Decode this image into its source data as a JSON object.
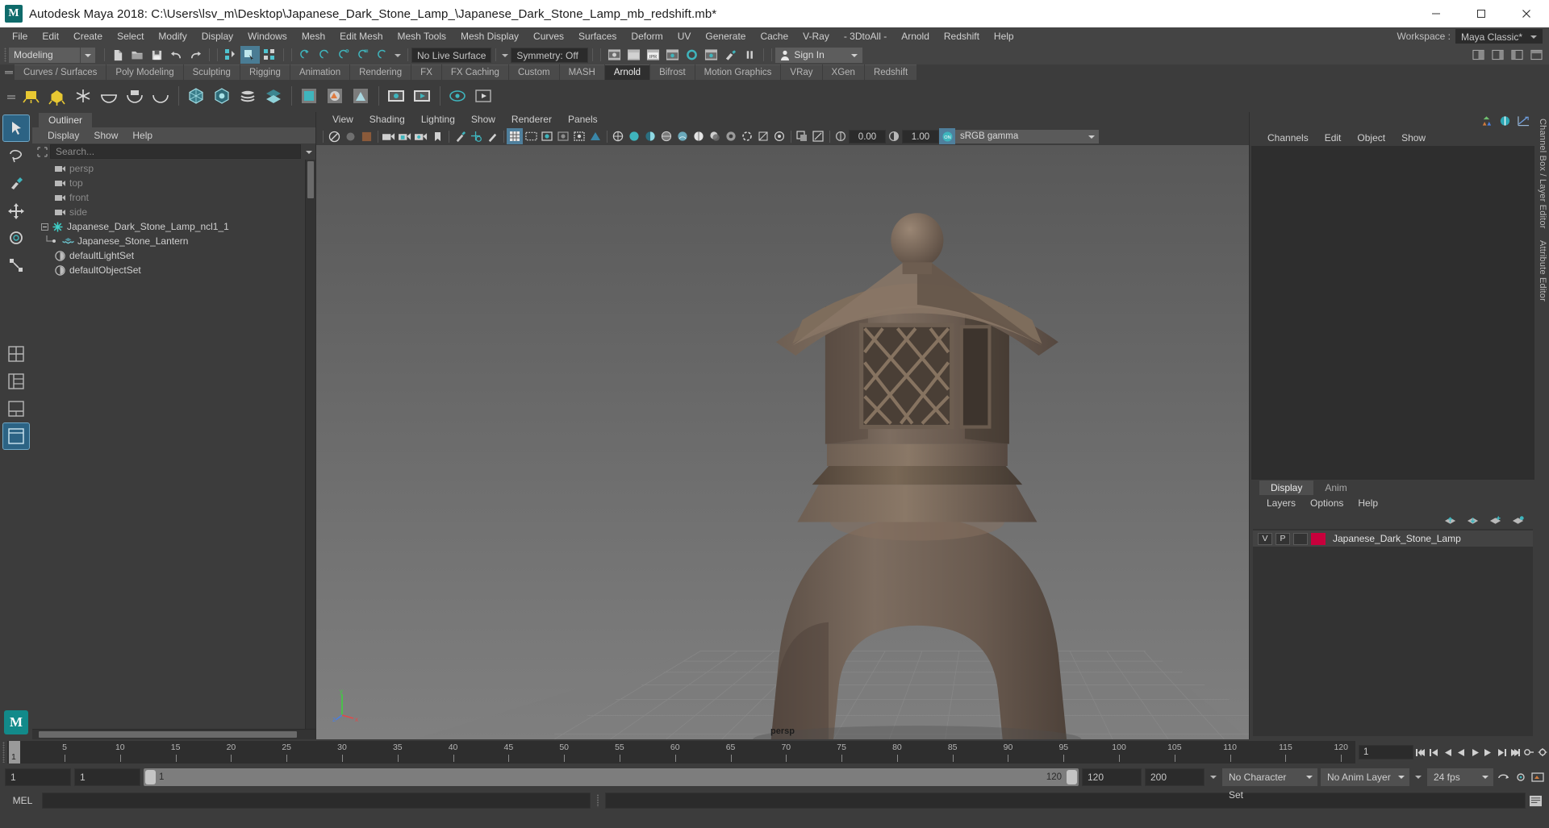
{
  "window": {
    "title": "Autodesk Maya 2018: C:\\Users\\lsv_m\\Desktop\\Japanese_Dark_Stone_Lamp_\\Japanese_Dark_Stone_Lamp_mb_redshift.mb*",
    "logo": "M",
    "minimize": "minimize-icon",
    "maximize": "maximize-icon",
    "close": "close-icon"
  },
  "menubar": {
    "items": [
      "File",
      "Edit",
      "Create",
      "Select",
      "Modify",
      "Display",
      "Windows",
      "Mesh",
      "Edit Mesh",
      "Mesh Tools",
      "Mesh Display",
      "Curves",
      "Surfaces",
      "Deform",
      "UV",
      "Generate",
      "Cache",
      "V-Ray",
      "- 3DtoAll -",
      "Arnold",
      "Redshift",
      "Help"
    ],
    "workspace_label": "Workspace :",
    "workspace_value": "Maya Classic*"
  },
  "statusline": {
    "mode": "Modeling",
    "live_surface": "No Live Surface",
    "symmetry": "Symmetry: Off",
    "signin": "Sign In"
  },
  "shelf": {
    "tabs": [
      "Curves / Surfaces",
      "Poly Modeling",
      "Sculpting",
      "Rigging",
      "Animation",
      "Rendering",
      "FX",
      "FX Caching",
      "Custom",
      "MASH",
      "Arnold",
      "Bifrost",
      "Motion Graphics",
      "VRay",
      "XGen",
      "Redshift"
    ],
    "selected_tab": "Arnold"
  },
  "outliner": {
    "tab": "Outliner",
    "menus": [
      "Display",
      "Show",
      "Help"
    ],
    "search_placeholder": "Search...",
    "items": [
      {
        "label": "persp",
        "icon": "camera-icon",
        "indent": 20,
        "dim": true,
        "expand": false
      },
      {
        "label": "top",
        "icon": "camera-icon",
        "indent": 20,
        "dim": true,
        "expand": false
      },
      {
        "label": "front",
        "icon": "camera-icon",
        "indent": 20,
        "dim": true,
        "expand": false
      },
      {
        "label": "side",
        "icon": "camera-icon",
        "indent": 20,
        "dim": true,
        "expand": false
      },
      {
        "label": "Japanese_Dark_Stone_Lamp_ncl1_1",
        "icon": "transform-star-icon",
        "indent": 6,
        "dim": false,
        "expand": true
      },
      {
        "label": "Japanese_Stone_Lantern",
        "icon": "mesh-icon",
        "indent": 30,
        "dim": false,
        "expand": false
      },
      {
        "label": "defaultLightSet",
        "icon": "set-icon",
        "indent": 20,
        "dim": false,
        "expand": false
      },
      {
        "label": "defaultObjectSet",
        "icon": "set-icon",
        "indent": 20,
        "dim": false,
        "expand": false
      }
    ]
  },
  "viewport": {
    "menus": [
      "View",
      "Shading",
      "Lighting",
      "Show",
      "Renderer",
      "Panels"
    ],
    "exposure": "0.00",
    "gamma": "1.00",
    "color_management": "sRGB gamma",
    "camera_label": "persp",
    "axis": {
      "y": "y",
      "z": "z",
      "x": "x"
    }
  },
  "rightpanel": {
    "channelbox_menus": [
      "Channels",
      "Edit",
      "Object",
      "Show"
    ],
    "vertical_tabs": [
      "Channel Box / Layer Editor",
      "Attribute Editor"
    ],
    "layer_tabs": [
      "Display",
      "Anim"
    ],
    "selected_layer_tab": "Display",
    "layer_menus": [
      "Layers",
      "Options",
      "Help"
    ],
    "layers": [
      {
        "visibility": "V",
        "playback": "P",
        "shading": "",
        "color": "#c8003c",
        "name": "Japanese_Dark_Stone_Lamp"
      }
    ]
  },
  "timeline": {
    "current_frame": "1",
    "ticks": [
      5,
      10,
      15,
      20,
      25,
      30,
      35,
      40,
      45,
      50,
      55,
      60,
      65,
      70,
      75,
      80,
      85,
      90,
      95,
      100,
      105,
      110,
      115,
      120
    ],
    "range_start_field": "1",
    "playback_field": "1"
  },
  "rangebar": {
    "start": "1",
    "start2": "1",
    "slider_min": "1",
    "slider_max": "120",
    "end": "120",
    "end2": "200",
    "character_set": "No Character Set",
    "anim_layer": "No Anim Layer",
    "fps": "24 fps"
  },
  "mel": {
    "label": "MEL",
    "command": "",
    "output": ""
  },
  "colors": {
    "accent": "#4f7f9c",
    "teal": "#3fb5bd",
    "layer_red": "#c8003c",
    "panel_bg": "#3c3c3c",
    "dark_bg": "#2e2e2e"
  }
}
